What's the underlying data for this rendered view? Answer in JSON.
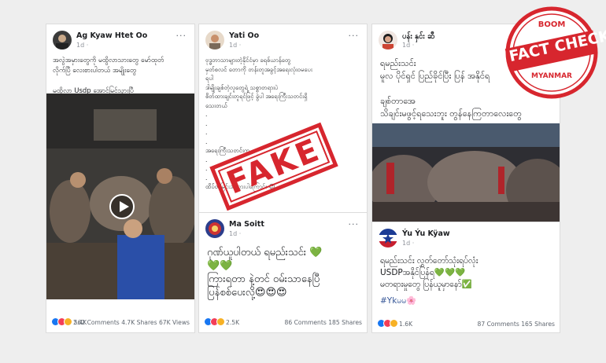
{
  "posts": [
    {
      "author": "Ag Kyaw Htet Oo",
      "time": "1d ·",
      "text": "အလွဲအမှားတွေကို မထွိလာသားတွေ မော်ထုတ်\nလိုက်ပြီ လေးစားပါတယ် အမျိုးတွေ\n\nမထွိလာ Usdp အောင်မြင်သွားပြီ",
      "reaction_count": "2.4K",
      "comments": "562 Comments",
      "shares": "4.7K Shares",
      "views": "67K Views"
    },
    {
      "author": "Yati Oo",
      "time": "1d ·",
      "text": "ဗုဒ္ဓဘာသာများတဲ့နိုင်ငံမှာ ခရစ်ယာန်တွေ\nမှတ်စလင် တောကို တန်းတူအခွင့်အရေးလုံးဝမပေး\nရပါ\nဒါမျိုးချစ်တဲ့လူတွေရဲ့ သစ္စာတရားပဲ\nစိတ်ထားချင်းတူရင်ဖြင့် ခွဲပါ အရေးကြီးသတင်းရှိ\nသေးတယ်\n.\n.\n.\n.\nအရေးကြီးသတင်းက\n.\n.\n.\nထိပ်တမြင်းအသွားပါကြောင်း 😍",
      "fake_label": "FAKE"
    },
    {
      "author": "Ma Soitt",
      "time": "1d ·",
      "text": "ဂုဏ်ယူပါတယ် ရမည်းသင်း 💚\n💚💚\nကြားရတာ နဲ့တင် ဝမ်းသာနေပြီ\nပြန်စစ်ပေးလို့😍😍😍",
      "reaction_count": "2.5K",
      "comments": "86 Comments",
      "shares": "185 Shares"
    },
    {
      "author": "ပန်း နှင်း ဆီ",
      "time": "1d ·",
      "text": "ရမည်းသင်း\nမူလ ပိုင်ရှင် ပြည်ခိုင်ပြီး ပြန် အနိုင်ရ\n\nချစ်တာအေ\nသိချင်းမဖွင့်ရသေးဘူး တွန်နေကြတာလေးတွေ"
    },
    {
      "author": "Ýu Ýu Kÿaw",
      "time": "1d ·",
      "text": "ရမည်းသင်း လွှတ်တော်သုံးရပ်လုံး\nUSDPအနိုင်ပြန်ရ💚💚💚\nမတရားမှုတွေ ပြန်ယူမှာနော်✅",
      "hashtag": "#Ykမမ🌸",
      "reaction_count": "1.6K",
      "comments": "87 Comments",
      "shares": "165 Shares"
    }
  ],
  "badge": {
    "top": "BOOM",
    "main_line1": "FACT",
    "main_line2": "CHECK",
    "bottom": "MYANMAR",
    "color": "#d7262e"
  },
  "colors": {
    "like": "#1877f2",
    "love": "#f33e58",
    "haha": "#f7b125"
  }
}
